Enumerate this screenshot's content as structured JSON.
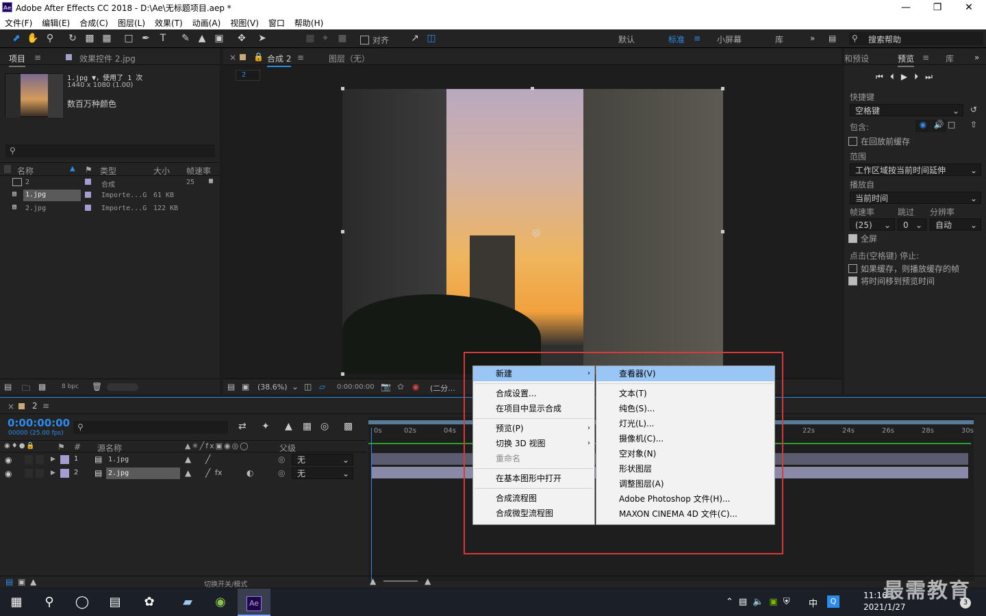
{
  "app": {
    "title": "Adobe After Effects CC 2018 - D:\\Ae\\无标题项目.aep *",
    "logo": "Ae",
    "window_controls": [
      "minimize-icon",
      "maximize-icon",
      "close-icon"
    ]
  },
  "menubar": [
    "文件(F)",
    "编辑(E)",
    "合成(C)",
    "图层(L)",
    "效果(T)",
    "动画(A)",
    "视图(V)",
    "窗口",
    "帮助(H)"
  ],
  "toolbar": {
    "snap_label": "对齐",
    "workspaces": [
      "默认",
      "标准",
      "小屏幕",
      "库"
    ],
    "active_workspace": "标准",
    "search_placeholder": "搜索帮助"
  },
  "project_panel": {
    "tab_project": "项目",
    "tab_effects": "效果控件 2.jpg",
    "item_name": "1.jpg",
    "item_usage": "，使用了 1 次",
    "item_dims": "1440 x 1080 (1.00)",
    "item_colors": "数百万种颜色",
    "columns": [
      "名称",
      "类型",
      "大小",
      "帧速率"
    ],
    "rows": [
      {
        "name": "2",
        "type": "合成",
        "size": "",
        "fps": "25"
      },
      {
        "name": "1.jpg",
        "type": "Importe...G",
        "size": "61 KB",
        "fps": ""
      },
      {
        "name": "2.jpg",
        "type": "Importe...G",
        "size": "122 KB",
        "fps": ""
      }
    ],
    "bpc": "8 bpc"
  },
  "comp_panel": {
    "tab": "合成 2",
    "layer_tab": "图层（无）",
    "breadcrumb": "2",
    "zoom": "(38.6%)",
    "timecode": "0:00:00:00",
    "resolution": "(二分..."
  },
  "preview_panel": {
    "tab_presets": "和预设",
    "tab_preview": "预览",
    "tab_lib": "库",
    "shortcut_label": "快捷键",
    "shortcut_value": "空格键",
    "include_label": "包含:",
    "cache_before": "在回放前缓存",
    "range_label": "范围",
    "range_value": "工作区域按当前时间延伸",
    "play_from_label": "播放自",
    "play_from_value": "当前时间",
    "fps_label": "帧速率",
    "skip_label": "跳过",
    "res_label": "分辨率",
    "fps_value": "(25)",
    "skip_value": "0",
    "res_value": "自动",
    "fullscreen": "全屏",
    "stop_label": "点击(空格键) 停止:",
    "if_cached": "如果缓存，则播放缓存的帧",
    "move_time": "将时间移到预览时间"
  },
  "timeline": {
    "tab": "2",
    "timecode": "0:00:00:00",
    "frames": "00000 (25.00 fps)",
    "col_source": "源名称",
    "col_parent": "父级",
    "ruler": [
      "0s",
      "02s",
      "04s",
      "22s",
      "24s",
      "26s",
      "28s",
      "30s"
    ],
    "layers": [
      {
        "num": "1",
        "name": "1.jpg",
        "parent": "无"
      },
      {
        "num": "2",
        "name": "2.jpg",
        "parent": "无"
      }
    ],
    "footer_label": "切换开关/模式"
  },
  "context_menu": {
    "main": [
      {
        "label": "新建",
        "submenu": true,
        "highlight": true
      },
      {
        "sep": true
      },
      {
        "label": "合成设置..."
      },
      {
        "label": "在项目中显示合成"
      },
      {
        "sep": true
      },
      {
        "label": "预览(P)",
        "submenu": true
      },
      {
        "label": "切换 3D 视图",
        "submenu": true
      },
      {
        "label": "重命名",
        "disabled": true
      },
      {
        "sep": true
      },
      {
        "label": "在基本图形中打开"
      },
      {
        "sep": true
      },
      {
        "label": "合成流程图"
      },
      {
        "label": "合成微型流程图"
      }
    ],
    "submenu": [
      {
        "label": "查看器(V)",
        "highlight": true
      },
      {
        "sep": true
      },
      {
        "label": "文本(T)"
      },
      {
        "label": "纯色(S)..."
      },
      {
        "label": "灯光(L)..."
      },
      {
        "label": "摄像机(C)..."
      },
      {
        "label": "空对象(N)"
      },
      {
        "label": "形状图层"
      },
      {
        "label": "调整图层(A)"
      },
      {
        "label": "Adobe Photoshop 文件(H)..."
      },
      {
        "label": "MAXON CINEMA 4D 文件(C)..."
      }
    ]
  },
  "taskbar": {
    "time": "11:16",
    "date": "2021/1/27",
    "ime": "中",
    "watermark": "最需教育",
    "notif_count": "3"
  },
  "colors": {
    "accent_blue": "#2d8ceb",
    "highlight_red": "#d83a3a",
    "menu_highlight": "#99c6f4",
    "timecode": "#2d8ceb"
  }
}
